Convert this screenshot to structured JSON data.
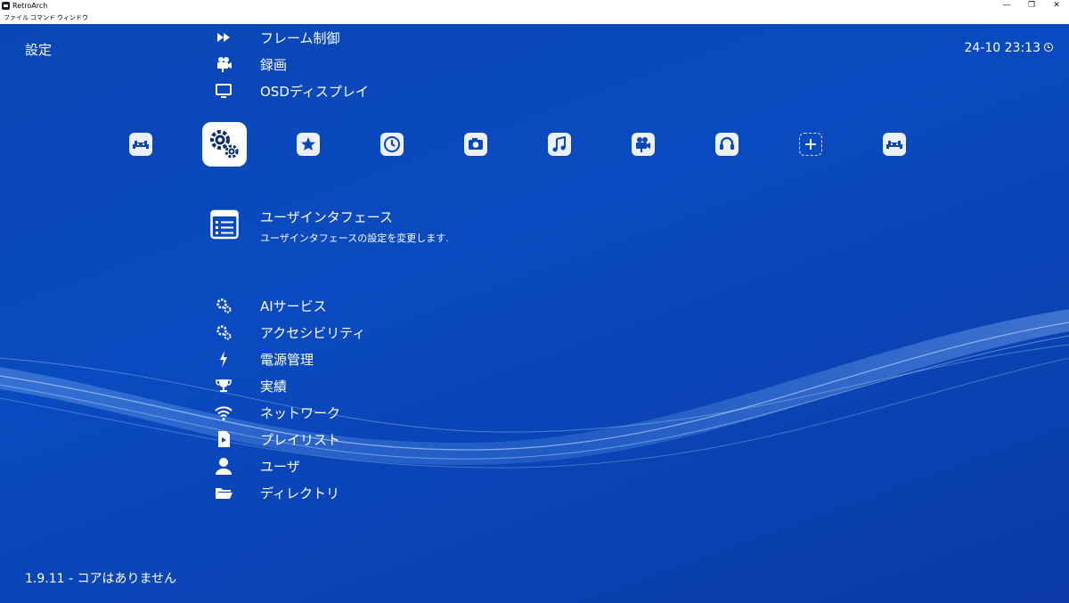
{
  "window": {
    "title": "RetroArch",
    "controls": {
      "minimize": "—",
      "restore": "❐",
      "close": "✕"
    }
  },
  "menubar": {
    "items": [
      "ファイル",
      "コマンド",
      "ウィンドウ"
    ]
  },
  "header": {
    "title": "設定",
    "clock": "24-10 23:13"
  },
  "top_items": [
    {
      "label": "フレーム制御",
      "icon": "fast-forward-icon"
    },
    {
      "label": "録画",
      "icon": "movie-camera-icon"
    },
    {
      "label": "OSDディスプレイ",
      "icon": "monitor-icon"
    }
  ],
  "categories": [
    {
      "name": "main-menu",
      "icon": "retroarch-invader-icon",
      "selected": false
    },
    {
      "name": "settings",
      "icon": "gears-icon",
      "selected": true
    },
    {
      "name": "favorites",
      "icon": "star-icon",
      "selected": false
    },
    {
      "name": "history",
      "icon": "clock-icon",
      "selected": false
    },
    {
      "name": "images",
      "icon": "camera-icon",
      "selected": false
    },
    {
      "name": "music",
      "icon": "music-note-icon",
      "selected": false
    },
    {
      "name": "videos",
      "icon": "movie-camera-icon",
      "selected": false
    },
    {
      "name": "netplay",
      "icon": "headset-icon",
      "selected": false
    },
    {
      "name": "import-content",
      "icon": "add-icon",
      "selected": false
    },
    {
      "name": "explore",
      "icon": "retroarch-invader-icon",
      "selected": false
    }
  ],
  "selected_item": {
    "title": "ユーザインタフェース",
    "description": "ユーザインタフェースの設定を変更します.",
    "icon": "list-icon"
  },
  "bottom_items": [
    {
      "label": "AIサービス",
      "icon": "gears-icon"
    },
    {
      "label": "アクセシビリティ",
      "icon": "gears-icon"
    },
    {
      "label": "電源管理",
      "icon": "lightning-icon"
    },
    {
      "label": "実績",
      "icon": "trophy-icon"
    },
    {
      "label": "ネットワーク",
      "icon": "wifi-icon"
    },
    {
      "label": "プレイリスト",
      "icon": "playlist-icon"
    },
    {
      "label": "ユーザ",
      "icon": "user-icon"
    },
    {
      "label": "ディレクトリ",
      "icon": "folder-icon"
    }
  ],
  "footer": {
    "version": "1.9.11 - コアはありません"
  },
  "colors": {
    "background": "#0a47b6",
    "text": "#ffffff",
    "wave": "#7fb8ff"
  }
}
